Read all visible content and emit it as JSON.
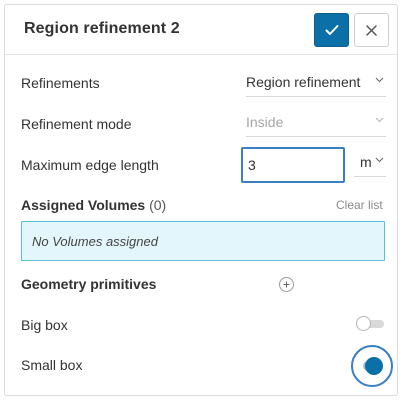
{
  "panel": {
    "title": "Region refinement 2"
  },
  "fields": {
    "refinements_label": "Refinements",
    "refinements_value": "Region refinement",
    "mode_label": "Refinement mode",
    "mode_value": "Inside",
    "max_edge_label": "Maximum edge length",
    "max_edge_value": "3",
    "max_edge_unit": "m"
  },
  "assigned": {
    "title": "Assigned Volumes",
    "count": "(0)",
    "clear_label": "Clear list",
    "empty_text": "No Volumes assigned"
  },
  "geometry": {
    "title": "Geometry primitives",
    "items": [
      {
        "label": "Big box",
        "enabled": false
      },
      {
        "label": "Small box",
        "enabled": true
      }
    ]
  },
  "colors": {
    "accent": "#0b6fa8",
    "focus_ring": "#3a7fc4",
    "assign_bg": "#e3f6fb",
    "assign_border": "#55c1d9"
  },
  "icons": {
    "confirm": "check-icon",
    "close": "close-icon",
    "dropdown": "chevron-down-icon",
    "add": "plus-icon"
  }
}
